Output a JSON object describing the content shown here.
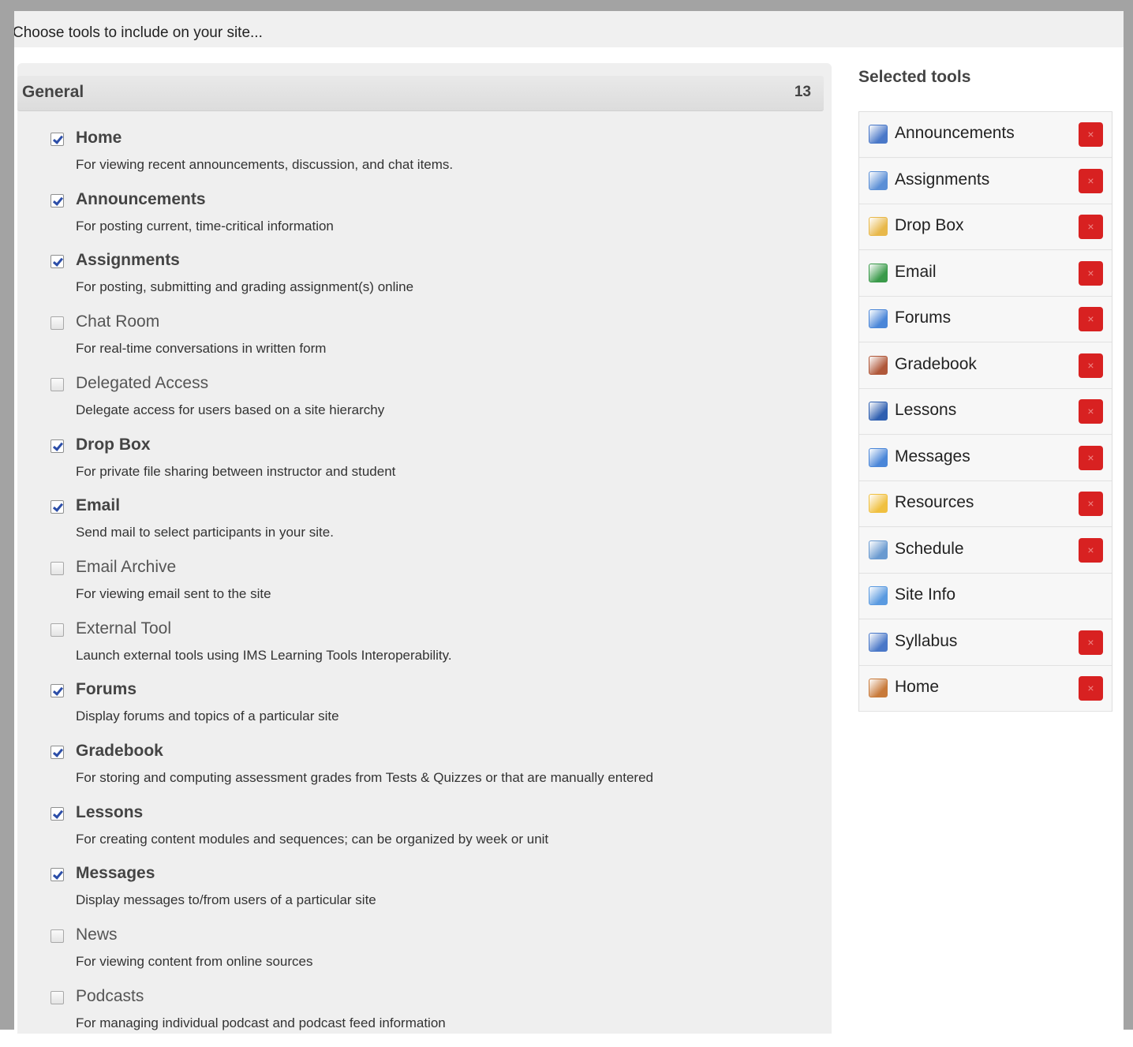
{
  "header": {
    "instruction": "Choose tools to include on your site..."
  },
  "group": {
    "title": "General",
    "count": "13"
  },
  "tools": [
    {
      "name": "Home",
      "desc": "For viewing recent announcements, discussion, and chat items.",
      "checked": true
    },
    {
      "name": "Announcements",
      "desc": "For posting current, time-critical information",
      "checked": true
    },
    {
      "name": "Assignments",
      "desc": "For posting, submitting and grading assignment(s) online",
      "checked": true
    },
    {
      "name": "Chat Room",
      "desc": "For real-time conversations in written form",
      "checked": false
    },
    {
      "name": "Delegated Access",
      "desc": "Delegate access for users based on a site hierarchy",
      "checked": false
    },
    {
      "name": "Drop Box",
      "desc": "For private file sharing between instructor and student",
      "checked": true
    },
    {
      "name": "Email",
      "desc": "Send mail to select participants in your site.",
      "checked": true
    },
    {
      "name": "Email Archive",
      "desc": "For viewing email sent to the site",
      "checked": false
    },
    {
      "name": "External Tool",
      "desc": "Launch external tools using IMS Learning Tools Interoperability.",
      "checked": false
    },
    {
      "name": "Forums",
      "desc": "Display forums and topics of a particular site",
      "checked": true
    },
    {
      "name": "Gradebook",
      "desc": "For storing and computing assessment grades from Tests & Quizzes or that are manually entered",
      "checked": true
    },
    {
      "name": "Lessons",
      "desc": "For creating content modules and sequences; can be organized by week or unit",
      "checked": true
    },
    {
      "name": "Messages",
      "desc": "Display messages to/from users of a particular site",
      "checked": true
    },
    {
      "name": "News",
      "desc": "For viewing content from online sources",
      "checked": false
    },
    {
      "name": "Podcasts",
      "desc": "For managing individual podcast and podcast feed information",
      "checked": false
    }
  ],
  "selected": {
    "title": "Selected tools",
    "remove_glyph": "×",
    "items": [
      {
        "label": "Announcements",
        "icon": "announcements-icon",
        "removable": true,
        "color": "#4a78c8"
      },
      {
        "label": "Assignments",
        "icon": "assignments-icon",
        "removable": true,
        "color": "#5b8fd6"
      },
      {
        "label": "Drop Box",
        "icon": "dropbox-icon",
        "removable": true,
        "color": "#e8b84a"
      },
      {
        "label": "Email",
        "icon": "email-icon",
        "removable": true,
        "color": "#3a9a4a"
      },
      {
        "label": "Forums",
        "icon": "forums-icon",
        "removable": true,
        "color": "#4a86d8"
      },
      {
        "label": "Gradebook",
        "icon": "gradebook-icon",
        "removable": true,
        "color": "#b0583a"
      },
      {
        "label": "Lessons",
        "icon": "lessons-icon",
        "removable": true,
        "color": "#2f5fb0"
      },
      {
        "label": "Messages",
        "icon": "messages-icon",
        "removable": true,
        "color": "#4a86d8"
      },
      {
        "label": "Resources",
        "icon": "resources-icon",
        "removable": true,
        "color": "#f0c040"
      },
      {
        "label": "Schedule",
        "icon": "schedule-icon",
        "removable": true,
        "color": "#6a9ad0"
      },
      {
        "label": "Site Info",
        "icon": "site-info-icon",
        "removable": false,
        "color": "#5a9ae0"
      },
      {
        "label": "Syllabus",
        "icon": "syllabus-icon",
        "removable": true,
        "color": "#4a78c8"
      },
      {
        "label": "Home",
        "icon": "home-icon",
        "removable": true,
        "color": "#c87a3a"
      }
    ]
  }
}
